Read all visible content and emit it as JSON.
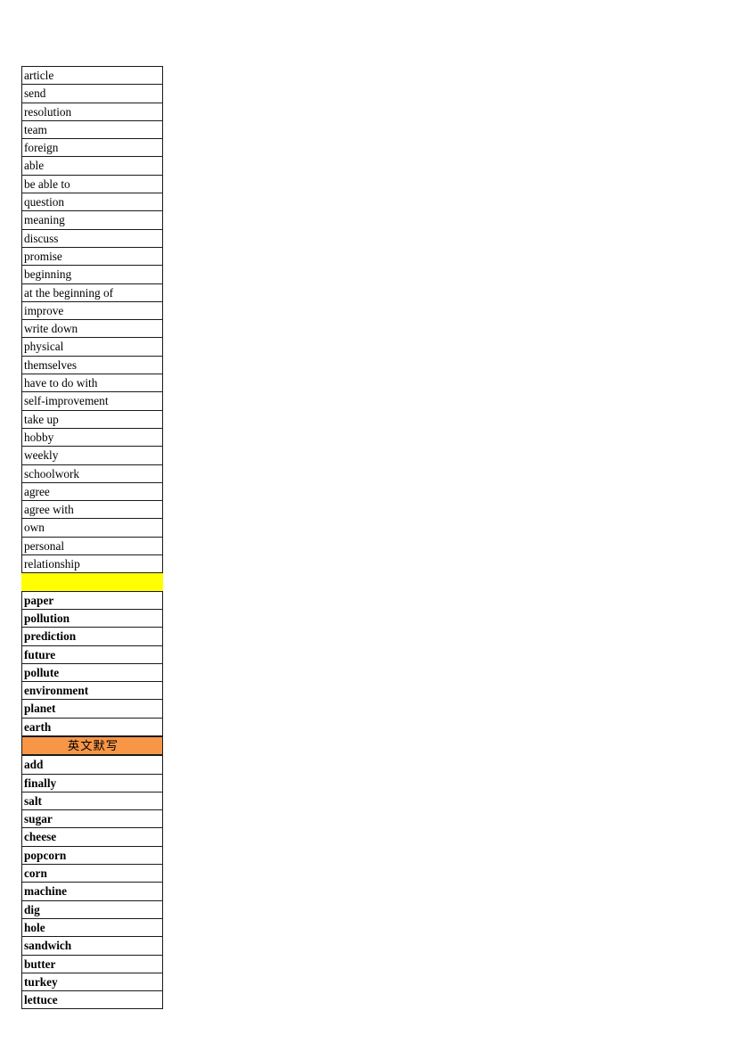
{
  "document": {
    "type": "spreadsheet-vocabulary-list",
    "colors": {
      "separator_yellow": "#FFFF00",
      "section_header_orange": "#F79646",
      "cell_border": "#1A1A1A",
      "cell_background": "#FFFFFF",
      "text": "#000000"
    }
  },
  "sections": [
    {
      "id": "section-unit-vocabulary-plain",
      "style": "plain",
      "rows": [
        "article",
        "send",
        "resolution",
        "team",
        "foreign",
        "able",
        "be able to",
        "question",
        "meaning",
        "discuss",
        "promise",
        "beginning",
        "at the beginning of",
        "improve",
        "write down",
        "physical",
        "themselves",
        "have to do with",
        "self-improvement",
        "take up",
        "hobby",
        "weekly",
        "schoolwork",
        "agree",
        "agree with",
        "own",
        "personal",
        "relationship"
      ]
    },
    {
      "id": "separator-yellow",
      "style": "separator",
      "fill": "#FFFF00",
      "label": ""
    },
    {
      "id": "section-environment-bold",
      "style": "bold",
      "rows": [
        "paper",
        "pollution",
        "prediction",
        "future",
        "pollute",
        "environment",
        "planet",
        "earth"
      ]
    },
    {
      "id": "section-header-dictation",
      "style": "header",
      "fill": "#F79646",
      "label": "英文默写"
    },
    {
      "id": "section-food-bold",
      "style": "bold",
      "rows": [
        "add",
        "finally",
        "salt",
        "sugar",
        "cheese",
        "popcorn",
        "corn",
        "machine",
        "dig",
        "hole",
        "sandwich",
        "butter",
        "turkey",
        "lettuce"
      ]
    }
  ]
}
